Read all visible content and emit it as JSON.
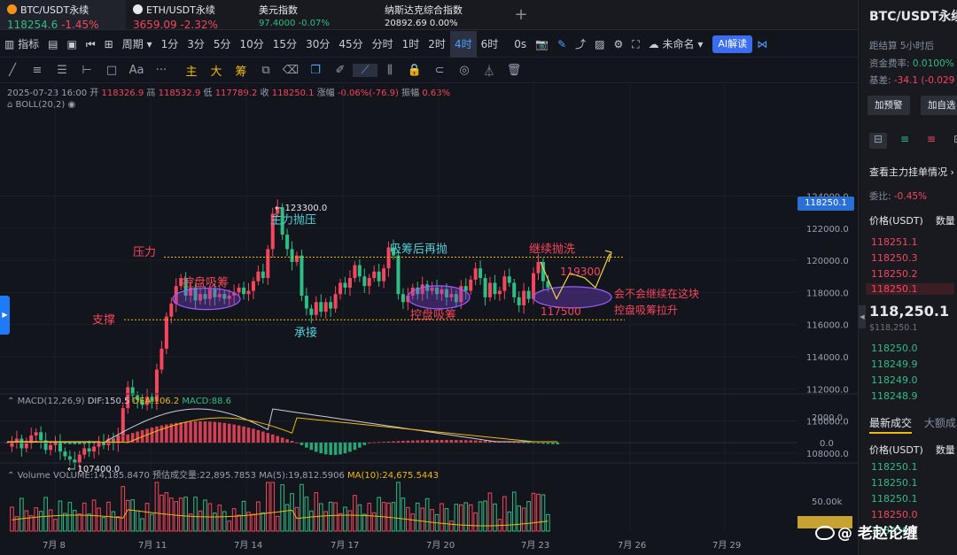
{
  "tickers": [
    {
      "name": "BTC/USDT永续",
      "price": "118254.6",
      "change": "-1.45%",
      "coin_color": "#f7931a"
    },
    {
      "name": "ETH/USDT永续",
      "price": "3659.09",
      "change": "-2.32%",
      "coin_color": "#e6e8ec"
    },
    {
      "name": "美元指数",
      "price": "97.4000",
      "change": "-0.07%"
    },
    {
      "name": "纳斯达克综合指数",
      "price": "20892.69",
      "change": "0.00%"
    }
  ],
  "add_tab": "+",
  "toolbar": {
    "indicator": "指标",
    "period": "周期",
    "intervals": [
      "1分",
      "3分",
      "5分",
      "10分",
      "15分",
      "30分",
      "45分",
      "分时",
      "1时",
      "2时",
      "4时",
      "6时"
    ],
    "active_interval": "4时",
    "zero_s": "0s",
    "layout_name": "未命名",
    "ai_button": "AI解读"
  },
  "drawing_tools": {
    "main": "主",
    "big": "大",
    "chou": "筹",
    "font": "Aa",
    "more": "···"
  },
  "ohlc": {
    "time": "2025-07-23 16:00",
    "open_label": "开",
    "open": "118326.9",
    "high_label": "高",
    "high": "118532.9",
    "low_label": "低",
    "low": "117789.2",
    "close_label": "收",
    "close": "118250.1",
    "chg_label": "涨幅",
    "chg": "-0.06%(-76.9)",
    "amp_label": "振幅",
    "amp": "0.63%"
  },
  "boll": "BOLL(20,2)",
  "macd": {
    "label": "MACD(12,26,9)",
    "dif": "DIF:150.5",
    "dea": "DEA:106.2",
    "macd": "MACD:88.6"
  },
  "volume": {
    "label": "Volume",
    "vol": "VOLUME:14,185.8470",
    "est": "预估成交量:22,895.7853",
    "ma5": "MA(5):19,812.5906",
    "ma10": "MA(10):24,675.5443"
  },
  "current_price_tag": "118250.1",
  "price_axis": [
    "124000.0",
    "122000.0",
    "120000.0",
    "118000.0",
    "116000.0",
    "114000.0",
    "112000.0",
    "110000.0",
    "108000.0"
  ],
  "macd_axis": [
    "2000.0",
    "0.0"
  ],
  "vol_axis": [
    "50.00k"
  ],
  "date_axis": [
    "7月 8",
    "7月 11",
    "7月 14",
    "7月 17",
    "7月 20",
    "7月 23",
    "7月 26",
    "7月 29"
  ],
  "annotations": {
    "high_marker": "123300.0",
    "low_marker": "107400.0",
    "main_sell": "主力抛压",
    "pressure": "压力",
    "support": "支撑",
    "accum1": "控盘吸筹",
    "accum2": "控盘吸筹",
    "catch": "承接",
    "absorb_then_sell": "吸筹后再抛",
    "keep_sell": "继续抛洗",
    "p1": "119300",
    "p2": "117500",
    "question1": "会不会继续在这块",
    "question2": "控盘吸筹拉升"
  },
  "right_panel": {
    "title": "BTC/USDT永续",
    "settle_label": "距结算",
    "settle_value": "5小时后",
    "rate_label": "资金费率:",
    "rate_value": "0.0100%",
    "basis_label": "基差:",
    "basis_value": "-34.1 (-0.029",
    "add_alert": "加预警",
    "add_watch": "加自选",
    "depth_title": "查看主力挂单情况",
    "ratio_label": "委比:",
    "ratio_value": "-0.45%",
    "col_price": "价格(USDT)",
    "col_qty": "数量",
    "asks": [
      "118251.1",
      "118250.3",
      "118250.2",
      "118250.1"
    ],
    "last_price": "118,250.1",
    "last_price_usd": "$118,250.1",
    "bids": [
      "118250.0",
      "118249.9",
      "118249.0",
      "118248.9"
    ],
    "tab_trades": "最新成交",
    "tab_big": "大额成",
    "trades_col_price": "价格(USDT)",
    "trades_col_qty": "数量",
    "trades": [
      "118250.1",
      "118250.1",
      "118250.1",
      "118250.0",
      "118250.1"
    ]
  },
  "watermark": "@ 老赵论缠",
  "colors": {
    "up": "#f6465d",
    "down": "#2ebd85",
    "accent": "#1f7af5",
    "annotation": "#f6465d",
    "cyan": "#4fd1d9"
  }
}
